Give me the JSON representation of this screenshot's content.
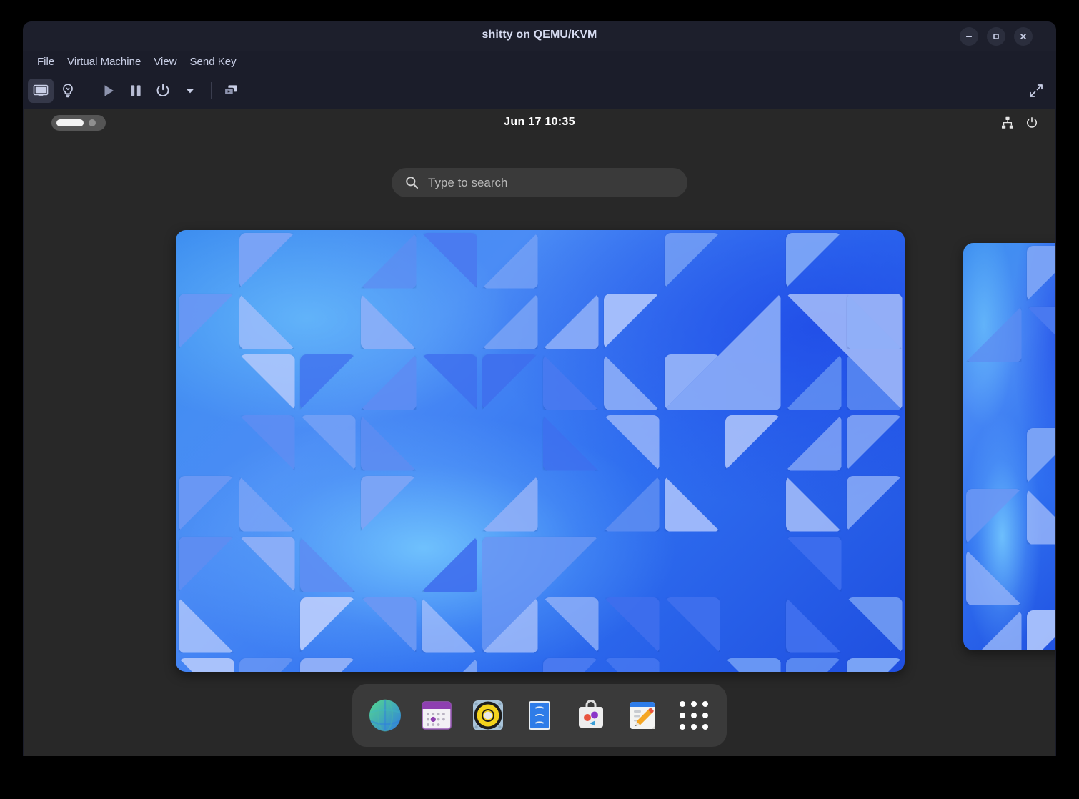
{
  "window": {
    "title": "shitty on QEMU/KVM",
    "controls": [
      {
        "name": "minimize-button",
        "icon": "minimize-icon",
        "label": "–"
      },
      {
        "name": "maximize-button",
        "icon": "maximize-icon",
        "label": "□"
      },
      {
        "name": "close-button",
        "icon": "close-icon",
        "label": "✕"
      }
    ]
  },
  "menubar": {
    "items": [
      {
        "label": "File"
      },
      {
        "label": "Virtual Machine"
      },
      {
        "label": "View"
      },
      {
        "label": "Send Key"
      }
    ]
  },
  "toolbar": {
    "buttons": [
      {
        "name": "show-console-button",
        "icon": "monitor-icon",
        "active": true
      },
      {
        "name": "show-details-button",
        "icon": "lightbulb-icon",
        "active": false
      },
      {
        "name": "run-button",
        "icon": "play-icon",
        "active": false
      },
      {
        "name": "pause-button",
        "icon": "pause-icon",
        "active": false
      },
      {
        "name": "shutdown-button",
        "icon": "power-icon",
        "active": false
      },
      {
        "name": "shutdown-menu-button",
        "icon": "chevron-down-icon",
        "active": false
      },
      {
        "name": "snapshots-button",
        "icon": "screens-icon",
        "active": false
      }
    ],
    "fullscreen": {
      "name": "fullscreen-button",
      "icon": "expand-arrows-icon"
    }
  },
  "guest": {
    "panel": {
      "clock": "Jun 17  10:35",
      "workspace_indicator": {
        "active_label": "",
        "other_count": 1
      },
      "status_icons": [
        {
          "name": "network-wired-icon"
        },
        {
          "name": "power-menu-icon"
        }
      ]
    },
    "search": {
      "placeholder": "Type to search",
      "value": "",
      "icon": "search-icon"
    },
    "overview": {
      "workspaces": [
        {
          "name": "workspace-thumbnail-current",
          "selected": true
        },
        {
          "name": "workspace-thumbnail-next",
          "selected": false
        }
      ]
    },
    "dock": {
      "items": [
        {
          "name": "dock-item-web",
          "icon": "globe-icon",
          "label": "Web"
        },
        {
          "name": "dock-item-calendar",
          "icon": "calendar-icon",
          "label": "Calendar"
        },
        {
          "name": "dock-item-music",
          "icon": "speaker-icon",
          "label": "Rhythmbox"
        },
        {
          "name": "dock-item-files",
          "icon": "file-cabinet-icon",
          "label": "Files"
        },
        {
          "name": "dock-item-software",
          "icon": "shopping-bag-icon",
          "label": "Software"
        },
        {
          "name": "dock-item-text-editor",
          "icon": "notepad-pencil-icon",
          "label": "Text Editor"
        },
        {
          "name": "dock-item-app-grid",
          "icon": "grid-dots-icon",
          "label": "Show Apps"
        }
      ]
    }
  },
  "colors": {
    "window_chrome": "#1b1d2a",
    "titlebar": "#1d1f2c",
    "menu_text": "#c9cfe6",
    "guest_shell": "#282828",
    "dock_bg": "rgba(60,60,60,0.92)",
    "wallpaper_blue": "#3d7ef0",
    "accent_white": "#ffffff",
    "page_bg": "#000000"
  }
}
